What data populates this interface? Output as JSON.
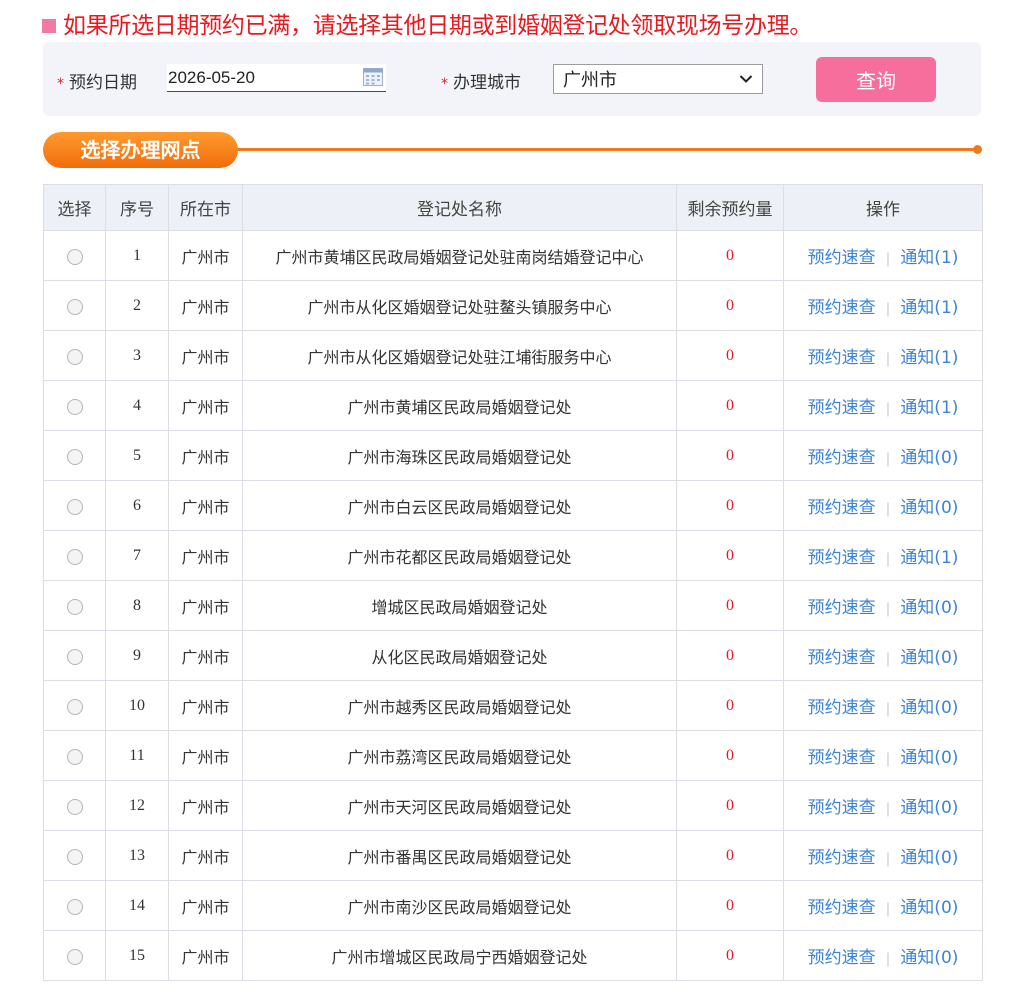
{
  "notice": {
    "text": "如果所选日期预约已满，请选择其他日期或到婚姻登记处领取现场号办理。"
  },
  "filters": {
    "date_label": "预约日期",
    "date_value": "2026-05-20",
    "city_label": "办理城市",
    "city_value": "广州市",
    "query_label": "查询",
    "required_mark": "*"
  },
  "section": {
    "title": "选择办理网点"
  },
  "table": {
    "headers": [
      "选择",
      "序号",
      "所在市",
      "登记处名称",
      "剩余预约量",
      "操作"
    ],
    "quick_check_label": "预约速查",
    "separator": "|",
    "rows": [
      {
        "no": "1",
        "city": "广州市",
        "name": "广州市黄埔区民政局婚姻登记处驻南岗结婚登记中心",
        "remaining": "0",
        "notice": "通知(1)"
      },
      {
        "no": "2",
        "city": "广州市",
        "name": "广州市从化区婚姻登记处驻鳌头镇服务中心",
        "remaining": "0",
        "notice": "通知(1)"
      },
      {
        "no": "3",
        "city": "广州市",
        "name": "广州市从化区婚姻登记处驻江埔街服务中心",
        "remaining": "0",
        "notice": "通知(1)"
      },
      {
        "no": "4",
        "city": "广州市",
        "name": "广州市黄埔区民政局婚姻登记处",
        "remaining": "0",
        "notice": "通知(1)"
      },
      {
        "no": "5",
        "city": "广州市",
        "name": "广州市海珠区民政局婚姻登记处",
        "remaining": "0",
        "notice": "通知(0)"
      },
      {
        "no": "6",
        "city": "广州市",
        "name": "广州市白云区民政局婚姻登记处",
        "remaining": "0",
        "notice": "通知(0)"
      },
      {
        "no": "7",
        "city": "广州市",
        "name": "广州市花都区民政局婚姻登记处",
        "remaining": "0",
        "notice": "通知(1)"
      },
      {
        "no": "8",
        "city": "广州市",
        "name": "增城区民政局婚姻登记处",
        "remaining": "0",
        "notice": "通知(0)"
      },
      {
        "no": "9",
        "city": "广州市",
        "name": "从化区民政局婚姻登记处",
        "remaining": "0",
        "notice": "通知(0)"
      },
      {
        "no": "10",
        "city": "广州市",
        "name": "广州市越秀区民政局婚姻登记处",
        "remaining": "0",
        "notice": "通知(0)"
      },
      {
        "no": "11",
        "city": "广州市",
        "name": "广州市荔湾区民政局婚姻登记处",
        "remaining": "0",
        "notice": "通知(0)"
      },
      {
        "no": "12",
        "city": "广州市",
        "name": "广州市天河区民政局婚姻登记处",
        "remaining": "0",
        "notice": "通知(0)"
      },
      {
        "no": "13",
        "city": "广州市",
        "name": "广州市番禺区民政局婚姻登记处",
        "remaining": "0",
        "notice": "通知(0)"
      },
      {
        "no": "14",
        "city": "广州市",
        "name": "广州市南沙区民政局婚姻登记处",
        "remaining": "0",
        "notice": "通知(0)"
      },
      {
        "no": "15",
        "city": "广州市",
        "name": "广州市增城区民政局宁西婚姻登记处",
        "remaining": "0",
        "notice": "通知(0)"
      }
    ]
  },
  "icons": {
    "calendar": "calendar-icon",
    "dropdown": "chevron-down-icon"
  },
  "colors": {
    "notice_red": "#e8191f",
    "accent_pink": "#f56e9c",
    "section_orange": "#ef7a1c",
    "link_blue": "#3d83d6"
  }
}
